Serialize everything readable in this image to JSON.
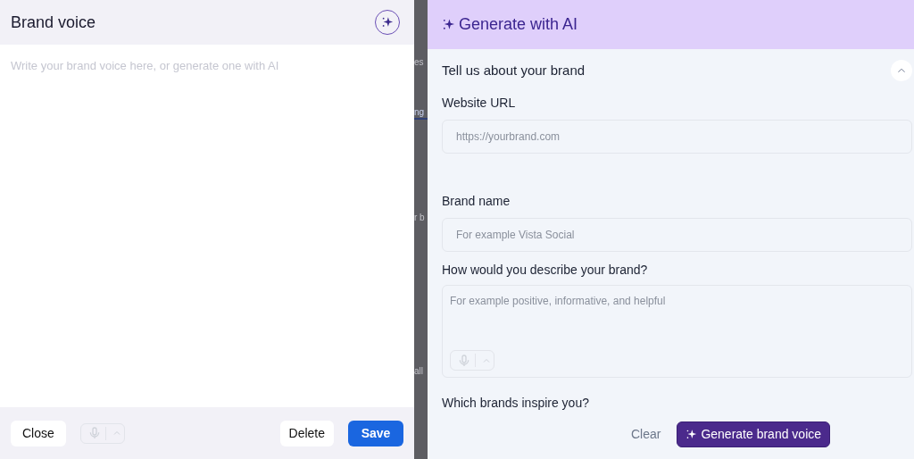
{
  "editor": {
    "title": "Brand voice",
    "placeholder": "Write your brand voice here, or generate one with AI",
    "buttons": {
      "close": "Close",
      "delete": "Delete",
      "save": "Save"
    }
  },
  "background_fragments": [
    {
      "text": "es",
      "underlined": false
    },
    {
      "text": "ng",
      "underlined": true
    },
    {
      "text": "r b",
      "underlined": false
    },
    {
      "text": "all",
      "underlined": false
    }
  ],
  "generator": {
    "title": "Generate with AI",
    "section": {
      "title": "Tell us about your brand",
      "expanded": true
    },
    "fields": [
      {
        "kind": "input",
        "label": "Website URL",
        "placeholder": "https://yourbrand.com"
      },
      {
        "kind": "input",
        "label": "Brand name",
        "placeholder": "For example Vista Social"
      },
      {
        "kind": "textarea",
        "label": "How would you describe your brand?",
        "placeholder": "For example positive, informative, and helpful"
      },
      {
        "kind": "label",
        "label": "Which brands inspire you?"
      }
    ],
    "buttons": {
      "clear": "Clear",
      "generate": "Generate brand voice"
    }
  }
}
